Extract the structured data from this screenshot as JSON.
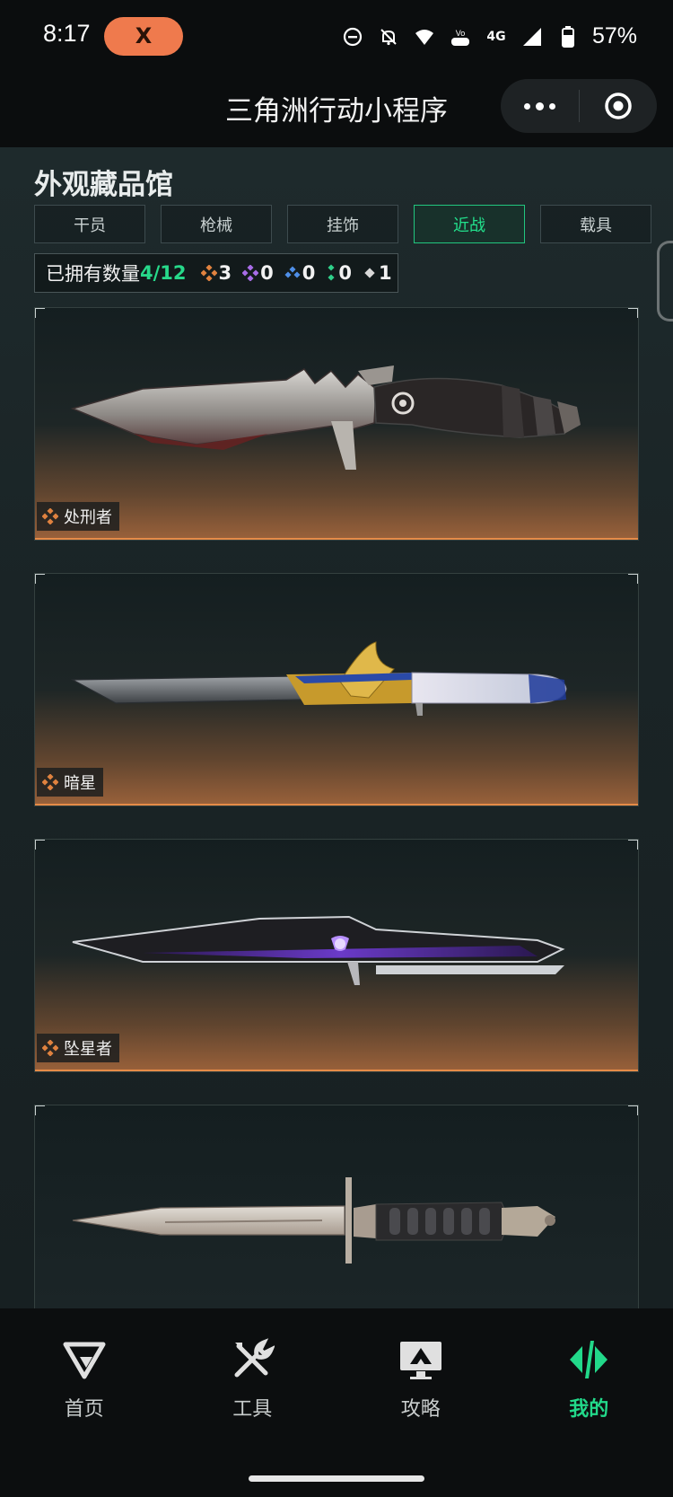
{
  "status_bar": {
    "time": "8:17",
    "pill_label": "X",
    "network": "4G",
    "battery": "57%"
  },
  "header": {
    "title": "三角洲行动小程序"
  },
  "page": {
    "section_title": "外观藏品馆",
    "tabs": [
      {
        "label": "干员",
        "active": false
      },
      {
        "label": "枪械",
        "active": false
      },
      {
        "label": "挂饰",
        "active": false
      },
      {
        "label": "近战",
        "active": true
      },
      {
        "label": "载具",
        "active": false
      }
    ],
    "owned": {
      "label": "已拥有数量",
      "count": "4/12",
      "rarities": [
        {
          "color": "#e0823f",
          "value": "3"
        },
        {
          "color": "#a86ce8",
          "value": "0"
        },
        {
          "color": "#4f8fe8",
          "value": "0"
        },
        {
          "color": "#2fd08a",
          "value": "0"
        },
        {
          "color": "#d8d8d8",
          "value": "1"
        }
      ]
    },
    "items": [
      {
        "name": "处刑者",
        "rarity_color": "#e0823f",
        "icon": "tactical-knife-icon"
      },
      {
        "name": "暗星",
        "rarity_color": "#e0823f",
        "icon": "gold-eagle-knife-icon"
      },
      {
        "name": "坠星者",
        "rarity_color": "#e0823f",
        "icon": "purple-blade-icon"
      },
      {
        "name": "",
        "rarity_color": "#d8d8d8",
        "icon": "bayonet-icon"
      }
    ]
  },
  "bottom_nav": [
    {
      "label": "首页",
      "icon": "home-logo-icon",
      "active": false
    },
    {
      "label": "工具",
      "icon": "tools-icon",
      "active": false
    },
    {
      "label": "攻略",
      "icon": "guide-monitor-icon",
      "active": false
    },
    {
      "label": "我的",
      "icon": "profile-logo-icon",
      "active": true
    }
  ],
  "colors": {
    "accent": "#22d98a",
    "rarity_orange": "#e0823f"
  }
}
